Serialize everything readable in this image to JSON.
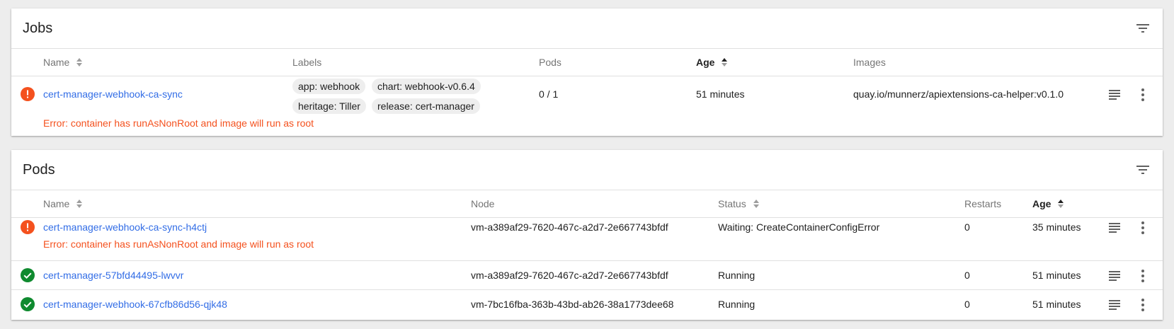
{
  "jobs": {
    "title": "Jobs",
    "columns": {
      "name": "Name",
      "labels": "Labels",
      "pods": "Pods",
      "age": "Age",
      "images": "Images"
    },
    "rows": [
      {
        "name": "cert-manager-webhook-ca-sync",
        "labels": [
          "app: webhook",
          "chart: webhook-v0.6.4",
          "heritage: Tiller",
          "release: cert-manager"
        ],
        "pods": "0 / 1",
        "age": "51 minutes",
        "images": "quay.io/munnerz/apiextensions-ca-helper:v0.1.0",
        "status": "error",
        "error": "Error: container has runAsNonRoot and image will run as root"
      }
    ]
  },
  "pods": {
    "title": "Pods",
    "columns": {
      "name": "Name",
      "node": "Node",
      "status": "Status",
      "restarts": "Restarts",
      "age": "Age"
    },
    "rows": [
      {
        "name": "cert-manager-webhook-ca-sync-h4ctj",
        "node": "vm-a389af29-7620-467c-a2d7-2e667743bfdf",
        "status_text": "Waiting: CreateContainerConfigError",
        "restarts": "0",
        "age": "35 minutes",
        "status": "error",
        "error": "Error: container has runAsNonRoot and image will run as root"
      },
      {
        "name": "cert-manager-57bfd44495-lwvvr",
        "node": "vm-a389af29-7620-467c-a2d7-2e667743bfdf",
        "status_text": "Running",
        "restarts": "0",
        "age": "51 minutes",
        "status": "ok"
      },
      {
        "name": "cert-manager-webhook-67cfb86d56-qjk48",
        "node": "vm-7bc16fba-363b-43bd-ab26-38a1773dee68",
        "status_text": "Running",
        "restarts": "0",
        "age": "51 minutes",
        "status": "ok"
      }
    ]
  },
  "icons": {
    "filter": "filter-icon",
    "logs": "logs-icon",
    "more": "more-vert-icon",
    "error": "error-icon",
    "ok": "check-circle-icon",
    "sort": "sort-icon"
  },
  "colors": {
    "link": "#326de6",
    "error": "#f4511e",
    "ok": "#0f8a2f",
    "background": "#ededed"
  }
}
